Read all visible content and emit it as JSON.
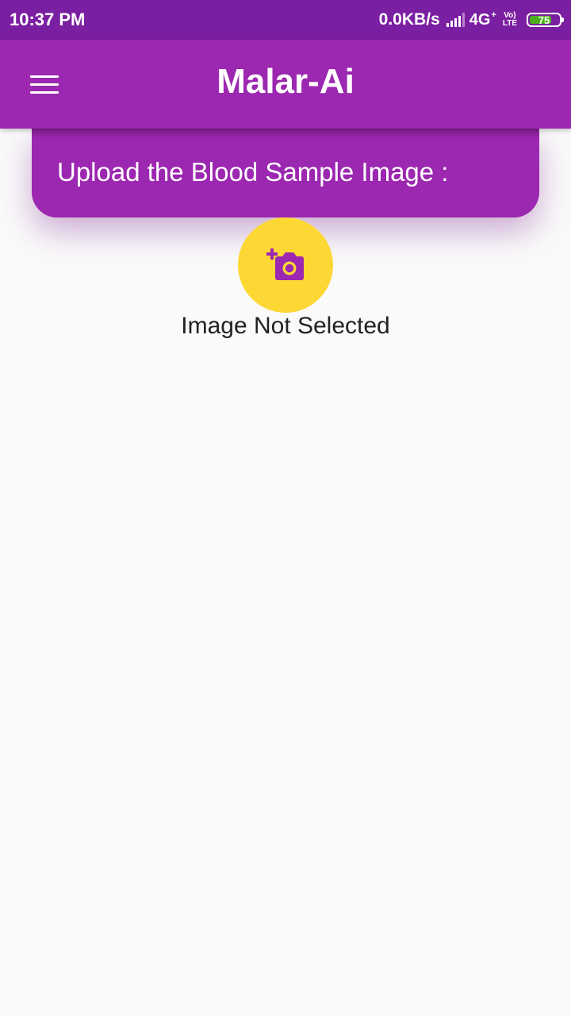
{
  "status_bar": {
    "time": "10:37 PM",
    "net_speed": "0.0KB/s",
    "network_type": "4G",
    "network_suffix": "+",
    "volte_top": "Vo)",
    "volte_bottom": "LTE",
    "battery_level": "75"
  },
  "app_bar": {
    "title": "Malar-Ai",
    "menu_icon": "menu-icon"
  },
  "upload_card": {
    "label": "Upload the Blood Sample Image :"
  },
  "camera_button": {
    "icon": "add-a-photo-icon"
  },
  "image_status": "Image Not Selected",
  "colors": {
    "status_bar": "#7b1fa2",
    "primary": "#9c27b0",
    "accent": "#fdd835",
    "background": "#fafafa",
    "battery": "#4caf1a"
  }
}
